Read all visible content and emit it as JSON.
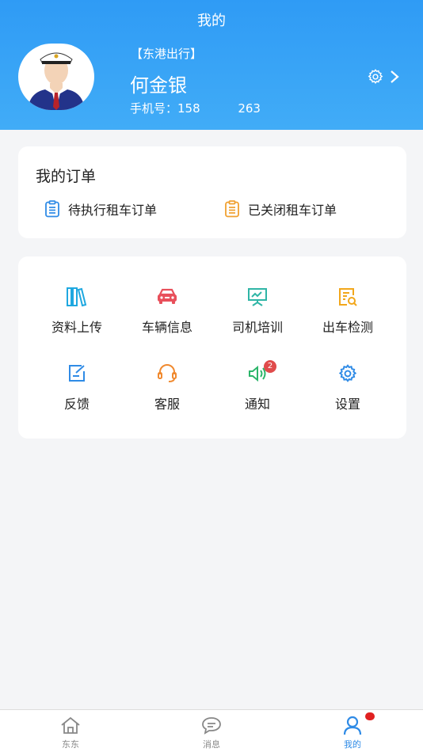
{
  "header": {
    "title": "我的",
    "company": "【东港出行】",
    "user_name": "何金银",
    "phone_label": "手机号：",
    "phone_prefix": "158",
    "phone_suffix": "263"
  },
  "orders": {
    "title": "我的订单",
    "pending_label": "待执行租车订单",
    "closed_label": "已关闭租车订单"
  },
  "grid": {
    "upload": "资料上传",
    "vehicle": "车辆信息",
    "training": "司机培训",
    "inspection": "出车检测",
    "feedback": "反馈",
    "service": "客服",
    "notice": "通知",
    "notice_badge": "2",
    "settings": "设置"
  },
  "tabs": {
    "home": "东东",
    "messages": "消息",
    "mine": "我的"
  },
  "colors": {
    "header_blue": "#2f9bf5",
    "tab_active": "#2f8be6",
    "badge_red": "#e04b4b"
  }
}
